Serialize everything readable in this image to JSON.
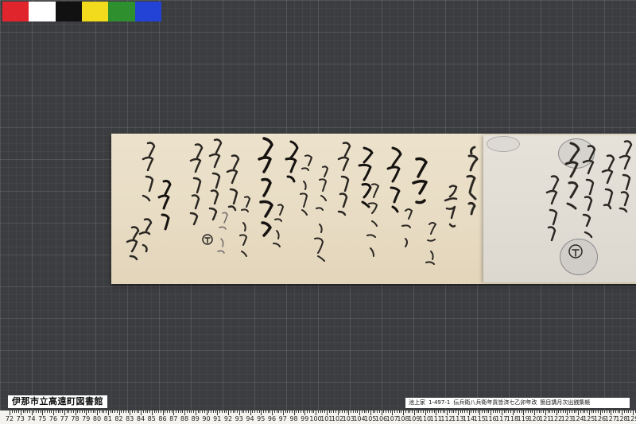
{
  "color_chart": {
    "swatches": [
      "#e0262c",
      "#ffffff",
      "#111111",
      "#f2da1c",
      "#2e8f2e",
      "#2343d6"
    ]
  },
  "library_label": "伊那市立高遠町図書館",
  "catalog_label": {
    "family": "池上家",
    "code": "1-497-1",
    "title": "伝兵衛八兵衛年貢皆済七乙卯年改",
    "subtitle": "箇目講月次出銭集帳"
  },
  "ruler": {
    "start": 72,
    "end": 129,
    "numbers": [
      "72",
      "73",
      "74",
      "75",
      "76",
      "77",
      "78",
      "79",
      "80",
      "81",
      "82",
      "83",
      "84",
      "85",
      "86",
      "87",
      "88",
      "89",
      "90",
      "91",
      "92",
      "93",
      "94",
      "95",
      "96",
      "97",
      "98",
      "99",
      "100",
      "101",
      "102",
      "103",
      "104",
      "105",
      "106",
      "107",
      "108",
      "109",
      "110",
      "111",
      "112",
      "113",
      "114",
      "115",
      "116",
      "117",
      "118",
      "119",
      "120",
      "121",
      "122",
      "123",
      "124",
      "125",
      "126",
      "127",
      "128",
      "129"
    ]
  },
  "document": {
    "date_line": "天保十二年十二月十六日",
    "name_line": "月次講 八",
    "seal_mark": "丁",
    "signature": "孫八"
  }
}
